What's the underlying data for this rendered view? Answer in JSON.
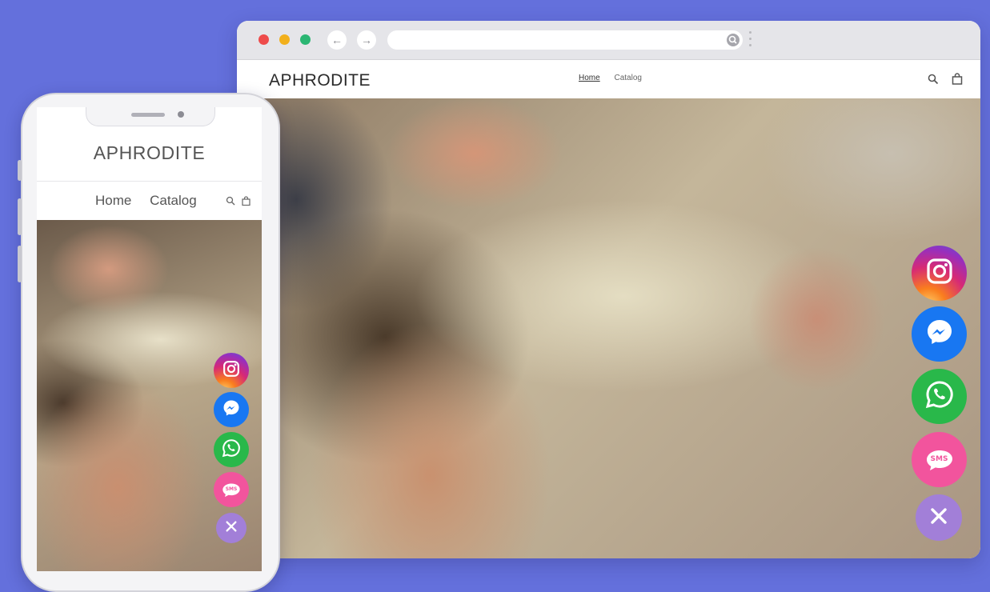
{
  "desktop": {
    "brand": "APHRODITE",
    "nav": [
      "Home",
      "Catalog"
    ],
    "icons": [
      "search-icon",
      "bag-icon"
    ],
    "hero_image": "photo of three women lying on a blanket"
  },
  "mobile": {
    "brand": "APHRODITE",
    "nav": [
      "Home",
      "Catalog"
    ],
    "icons": [
      "search-icon",
      "bag-icon"
    ]
  },
  "social_buttons": [
    {
      "name": "instagram",
      "icon": "instagram-icon",
      "color": "#d62976"
    },
    {
      "name": "messenger",
      "icon": "messenger-icon",
      "color": "#1877f2"
    },
    {
      "name": "whatsapp",
      "icon": "whatsapp-icon",
      "color": "#29b84a"
    },
    {
      "name": "sms",
      "icon": "sms-icon",
      "label": "SMS",
      "color": "#f2549d"
    },
    {
      "name": "close",
      "icon": "close-icon",
      "color": "#a27fd8"
    }
  ],
  "colors": {
    "background": "#6470dc"
  }
}
